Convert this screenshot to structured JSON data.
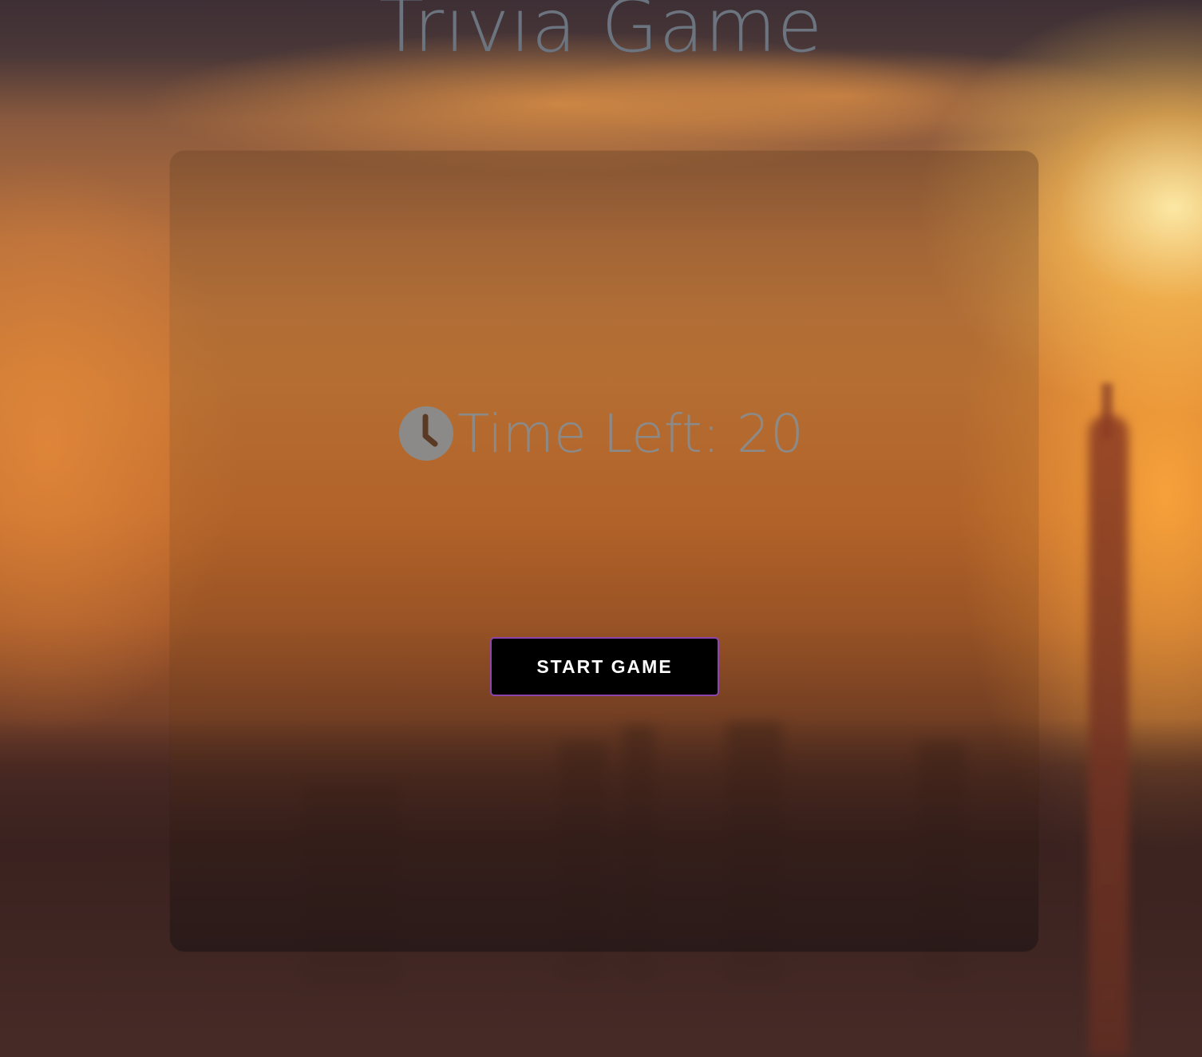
{
  "header": {
    "title": "Trivia Game"
  },
  "timer": {
    "icon": "clock-icon",
    "label": "Time Left: ",
    "seconds": "20"
  },
  "controls": {
    "start_label": "START GAME"
  },
  "colors": {
    "title": "#6b747f",
    "timer_text": "#8c8a88",
    "button_bg": "#000000",
    "button_border": "#8e44ad",
    "button_text": "#ffffff"
  }
}
